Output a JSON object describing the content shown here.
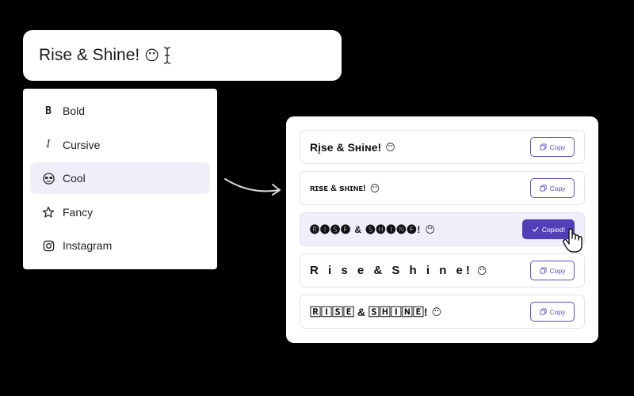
{
  "input": {
    "value": "Rise & Shine!",
    "emoji": "😶"
  },
  "menu": {
    "items": [
      {
        "label": "Bold",
        "icon": "bold-icon",
        "glyph": "B"
      },
      {
        "label": "Cursive",
        "icon": "italic-icon",
        "glyph": "I"
      },
      {
        "label": "Cool",
        "icon": "sunglasses-icon",
        "glyph": "😎"
      },
      {
        "label": "Fancy",
        "icon": "star-icon",
        "glyph": "☆"
      },
      {
        "label": "Instagram",
        "icon": "instagram-icon",
        "glyph": ""
      }
    ],
    "active_index": 2
  },
  "results": [
    {
      "text": "Rįse & Sʜiɴe!",
      "emoji": "😶",
      "button": "Copy"
    },
    {
      "text": "ʀɪꜱᴇ & ꜱʜɪɴᴇ!",
      "emoji": "😶",
      "button": "Copy"
    },
    {
      "text": "🅡🅘🅢🅔 & 🅢🅗🅘🅝🅔!",
      "emoji": "😶",
      "button": "Copied!"
    },
    {
      "text": "R i s e & S h i n e!",
      "emoji": "😶",
      "button": "Copy"
    },
    {
      "text": "🅁🄸🅂🄴 & 🅂🄷🄸🄽🄴!",
      "emoji": "😶",
      "button": "Copy"
    }
  ],
  "colors": {
    "background": "#000000",
    "accent": "#4f3fb8",
    "active_item": "#efeefa"
  }
}
